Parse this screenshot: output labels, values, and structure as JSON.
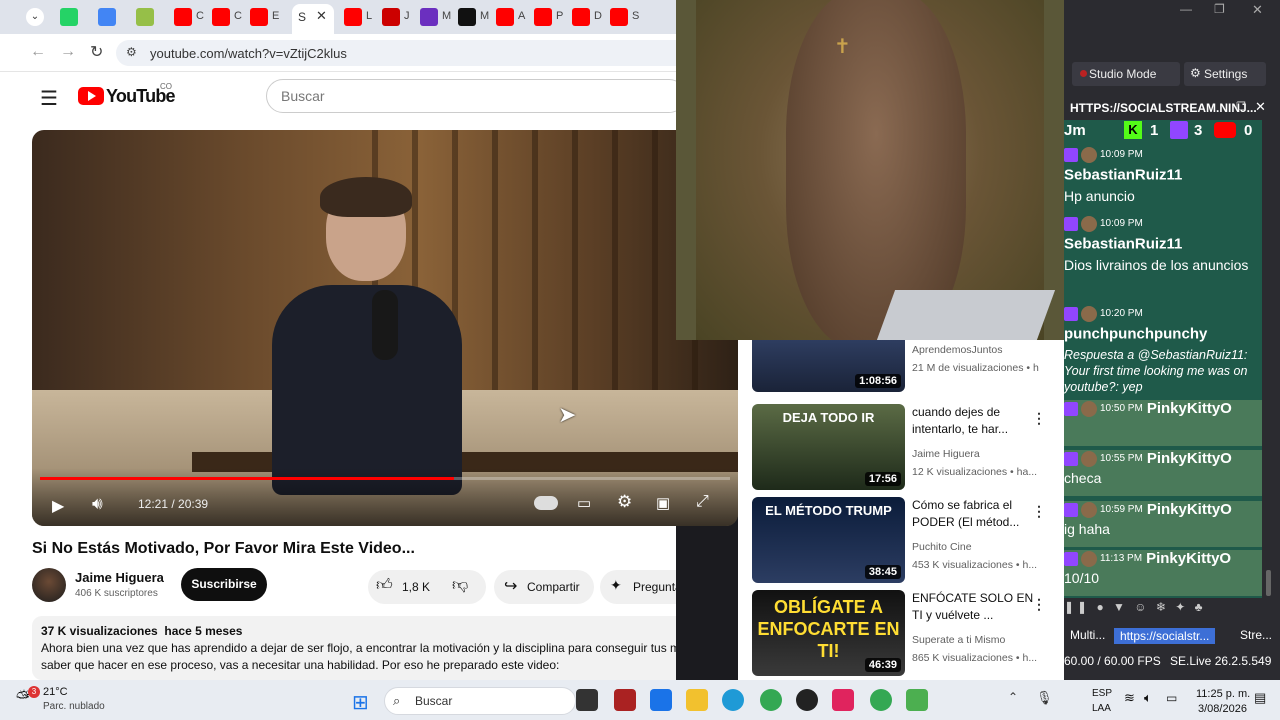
{
  "browser": {
    "tabs": [
      {
        "icon": "whatsapp-icon",
        "label": ""
      },
      {
        "icon": "google-icon",
        "label": ""
      },
      {
        "icon": "shopify-icon",
        "label": ""
      },
      {
        "icon": "youtube-icon",
        "label": "C"
      },
      {
        "icon": "youtube-icon",
        "label": "C"
      },
      {
        "icon": "youtube-icon",
        "label": "E"
      },
      {
        "icon": "youtube-icon",
        "label": "S"
      },
      {
        "icon": "youtube-icon",
        "label": "L"
      },
      {
        "icon": "youtube-music-icon",
        "label": "J"
      },
      {
        "icon": "app-icon",
        "label": "M"
      },
      {
        "icon": "m-icon",
        "label": "M"
      },
      {
        "icon": "youtube-icon",
        "label": "A"
      },
      {
        "icon": "youtube-icon",
        "label": "P"
      },
      {
        "icon": "youtube-icon",
        "label": "D"
      },
      {
        "icon": "youtube-icon",
        "label": "S"
      }
    ],
    "active_tab_label": "S",
    "url": "youtube.com/watch?v=vZtijC2klus"
  },
  "youtube": {
    "logo_text": "YouTube",
    "country": "CO",
    "search_placeholder": "Buscar",
    "player": {
      "time": "12:21 / 20:39",
      "progress": 0.6
    },
    "video_title": "Si No Estás Motivado, Por Favor Mira Este Video...",
    "channel": {
      "name": "Jaime Higuera",
      "subscribers": "406 K suscriptores",
      "subscribe_label": "Suscribirse"
    },
    "actions": {
      "likes": "1,8 K",
      "share": "Compartir",
      "ask": "Preguntar"
    },
    "description": {
      "stats": "37 K visualizaciones  hace 5 meses",
      "text": "Ahora bien una vez que has aprendido a dejar de ser flojo, a encontrar la motivación y la disciplina para conseguir tus metas, y saber que hacer en ese proceso, vas a necesitar una habilidad. Por eso he preparado este video:"
    },
    "related": [
      {
        "title": "",
        "channel": "AprendemosJuntos",
        "views": "21 M de visualizaciones • h",
        "duration": "1:08:56",
        "thumb_text": ""
      },
      {
        "title": "cuando dejes de intentarlo, te har...",
        "channel": "Jaime Higuera",
        "views": "12 K visualizaciones • ha...",
        "duration": "17:56",
        "thumb_text": "DEJA TODO IR"
      },
      {
        "title": "Cómo se fabrica el PODER (El métod...",
        "channel": "Puchito Cine",
        "views": "453 K visualizaciones • h...",
        "duration": "38:45",
        "thumb_text": "EL MÉTODO TRUMP"
      },
      {
        "title": "ENFÓCATE SOLO EN TI y vuélvete ...",
        "channel": "Superate a ti Mismo",
        "views": "865 K visualizaciones • h...",
        "duration": "46:39",
        "thumb_text": "OBLÍGATE A ENFOCARTE EN TI!"
      }
    ]
  },
  "obs": {
    "studio_mode": "Studio Mode",
    "settings": "Settings",
    "dock_title": "HTTPS://SOCIALSTREAM.NINJ...",
    "counts": {
      "prefix": "Jm",
      "kick": "1",
      "twitch": "3",
      "youtube": "0"
    },
    "messages": [
      {
        "time": "10:09 PM",
        "user": "SebastianRuiz11",
        "text": "Hp anuncio",
        "italic": false
      },
      {
        "time": "10:09 PM",
        "user": "SebastianRuiz11",
        "text": "Dios livrainos de los anuncios",
        "italic": false
      },
      {
        "time": "10:20 PM",
        "user": "punchpunchpunchy",
        "text": "Respuesta a @SebastianRuiz11: Your first time looking me was on youtube?: yep",
        "italic": true
      },
      {
        "time": "10:50 PM",
        "user": "PinkyKittyO",
        "text": "",
        "italic": false
      },
      {
        "time": "10:55 PM",
        "user": "PinkyKittyO",
        "text": "checa",
        "italic": false
      },
      {
        "time": "10:59 PM",
        "user": "PinkyKittyO",
        "text": "ig haha",
        "italic": false
      },
      {
        "time": "11:13 PM",
        "user": "PinkyKittyO",
        "text": "10/10",
        "italic": false
      }
    ],
    "bottom_tabs": [
      "Multi...",
      "https://socialstr...",
      "Stre..."
    ],
    "fps": "60.00 / 60.00 FPS",
    "version": "SE.Live 26.2.5.549"
  },
  "taskbar": {
    "weather_temp": "21°C",
    "weather_desc": "Parc. nublado",
    "weather_badge": "3",
    "search_label": "Buscar",
    "lang1": "ESP",
    "lang2": "LAA",
    "time": "11:25 p. m.",
    "date": "3/08/2026"
  }
}
